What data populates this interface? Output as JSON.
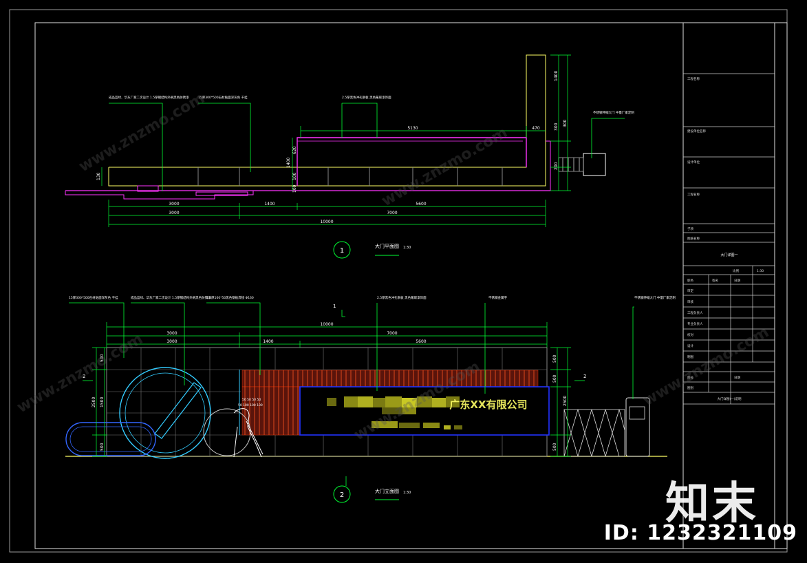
{
  "plan": {
    "number": "1",
    "title": "大门平面图",
    "scale": "1:30",
    "labels": {
      "left_material": "成品蓝绿、华东厂家二次设计\n1.5厚钢结构外刷黑色防锈漆",
      "wall_material": "15厚300*500石材贴面深灰色\n干挂",
      "mid_material": "2.5厚黑色冲孔钢板\n黑色氟碳漆饰面",
      "right_material": "不锈钢伸缩大门\n中量厂家定制"
    },
    "dims": {
      "top_run": "5130",
      "corner": "470",
      "h1": "620",
      "h2": "100",
      "h3": "100",
      "h4": "300",
      "h5": "1400",
      "v_right1": "1400",
      "v_right2": "300",
      "v_right3": "200",
      "left_h": "130",
      "bottom_a": "3000",
      "bottom_b": "1400",
      "bottom_c": "5600",
      "bottom_d": "3000",
      "bottom_e": "7000",
      "bottom_total": "10000"
    }
  },
  "elevation": {
    "number": "2",
    "title": "大门立面图",
    "scale": "1:30",
    "section_mark": "1",
    "side_mark_left": "2",
    "side_mark_right": "2",
    "company_sign": "广东XX有限公司",
    "labels": {
      "l1": "15厚300*500石材贴面深灰色\n干挂",
      "l2": "成品蓝绿、华东厂家二次设计\n1.5厚钢结构外刷黑色防锈漆",
      "l3": "2.0厚100*50黑色钢板焊接\nΦ160",
      "l4": "2.5厚黑色冲孔钢板\n黑色氟碳漆饰面",
      "l5": "不锈钢金属字",
      "l6": "不锈钢伸缩大门\n中量厂家定制"
    },
    "dims": {
      "total": "10000",
      "a": "3000",
      "b": "7000",
      "c": "3000",
      "d": "1400",
      "e": "5600",
      "left_v1": "500",
      "left_v2": "1500",
      "left_v3": "500",
      "left_total": "2500",
      "right_v1": "500",
      "right_v2": "500",
      "right_total": "2500",
      "slat_dims": "50 50 50 50",
      "slat_dims2": "50 100 100 100"
    }
  },
  "title_block": {
    "rows": [
      "工程名称",
      "建设单位名称",
      "设计单位",
      "工程名称",
      "子项",
      "图纸名称",
      "大门详图一"
    ],
    "sign_cols": [
      "职务",
      "签名",
      "日期"
    ],
    "sign_rows": [
      "审定",
      "审核",
      "工程负责人",
      "专业负责人",
      "校对",
      "设计",
      "制图"
    ],
    "meta": [
      "比例",
      "1:30",
      "图号",
      "日期",
      "图别"
    ],
    "footer": "大门详图(一)说明"
  },
  "watermark": {
    "logo": "知末",
    "id": "ID: 1232321109",
    "site": "www.znzmo.com"
  },
  "colors": {
    "frame": "#ffffff",
    "yellow": "#ffff66",
    "green": "#00ff33",
    "magenta": "#ff33ff",
    "cyan": "#33ccff",
    "red": "#ff3300",
    "blue": "#2233ff",
    "wall": "#c8c8c8"
  }
}
